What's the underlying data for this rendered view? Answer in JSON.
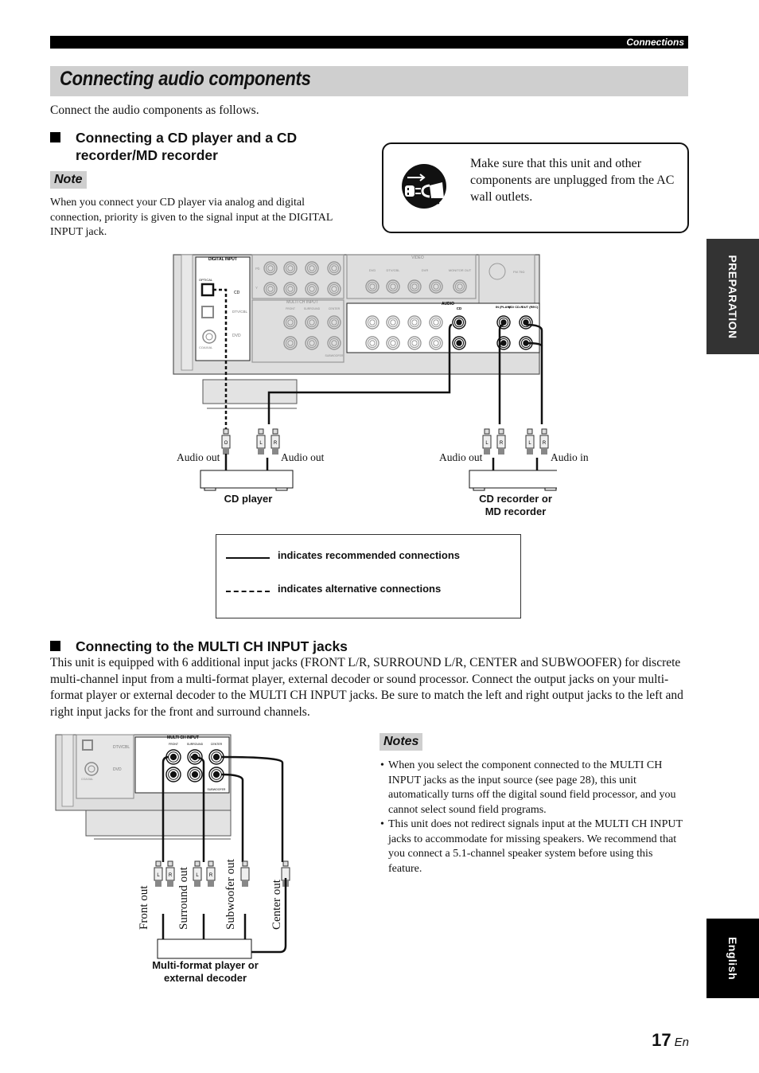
{
  "header": {
    "section": "Connections"
  },
  "title": "Connecting audio components",
  "intro": "Connect the audio components as follows.",
  "section1": {
    "heading_line1": "Connecting a CD player and a CD",
    "heading_line2": "recorder/MD recorder",
    "note_label": "Note",
    "note_text": "When you connect your CD player via analog and digital connection, priority is given to the signal input at the DIGITAL INPUT jack.",
    "warning": {
      "icon": "unplug-icon",
      "text": "Make sure that this unit and other components are unplugged from the AC wall outlets."
    },
    "diagram": {
      "panel_labels": {
        "digital_input": "DIGITAL INPUT",
        "optical": "OPTICAL",
        "coaxial": "COAXIAL",
        "cd": "CD",
        "dtv_cbl": "DTV/CBL",
        "dvd": "DVD",
        "multi_ch_input": "MULTI CH INPUT",
        "front": "FRONT",
        "surround": "SURROUND",
        "center": "CENTER",
        "subwoofer": "SUBWOOFER",
        "video": "VIDEO",
        "audio": "AUDIO",
        "dvr": "DVR",
        "in": "IN",
        "out": "OUT",
        "monitor_out": "MONITOR OUT",
        "fm": "FM 75Ω",
        "md_cdr": "MD/ CD-R",
        "in_play": "IN (PLAY)",
        "out_rec": "OUT (REC)",
        "pb": "Pb",
        "y": "Y"
      },
      "plug_labels": {
        "optical": "O",
        "left": "L",
        "right": "R"
      },
      "cd_player": {
        "label": "CD player",
        "out1": "Audio out",
        "out2": "Audio out"
      },
      "recorder": {
        "label_line1": "CD recorder or",
        "label_line2": "MD recorder",
        "out": "Audio out",
        "in": "Audio in"
      }
    },
    "legend": {
      "recommended": "indicates recommended connections",
      "alternative": "indicates alternative connections"
    }
  },
  "section2": {
    "heading": "Connecting to the MULTI CH INPUT jacks",
    "body": "This unit is equipped with 6 additional input jacks (FRONT L/R, SURROUND L/R, CENTER and SUBWOOFER) for discrete multi-channel input from a multi-format player, external decoder or sound processor. Connect the output jacks on your multi-format player or external decoder to the MULTI CH INPUT jacks. Be sure to match the left and right output jacks to the left and right input jacks for the front and surround channels.",
    "diagram": {
      "outputs": [
        "Front out",
        "Surround out",
        "Subwoofer out",
        "Center out"
      ],
      "device_line1": "Multi-format player or",
      "device_line2": "external decoder"
    },
    "notes_label": "Notes",
    "notes": [
      "When you select the component connected to the MULTI CH INPUT jacks as the input source (see page 28), this unit automatically turns off the digital sound field processor, and you cannot select sound field programs.",
      "This unit does not redirect signals input at the MULTI CH INPUT jacks to accommodate for missing speakers. We recommend that you connect a 5.1-channel speaker system before using this feature."
    ]
  },
  "side_tabs": {
    "preparation": "PREPARATION",
    "language": "English"
  },
  "footer": {
    "page": "17",
    "lang": "En"
  }
}
